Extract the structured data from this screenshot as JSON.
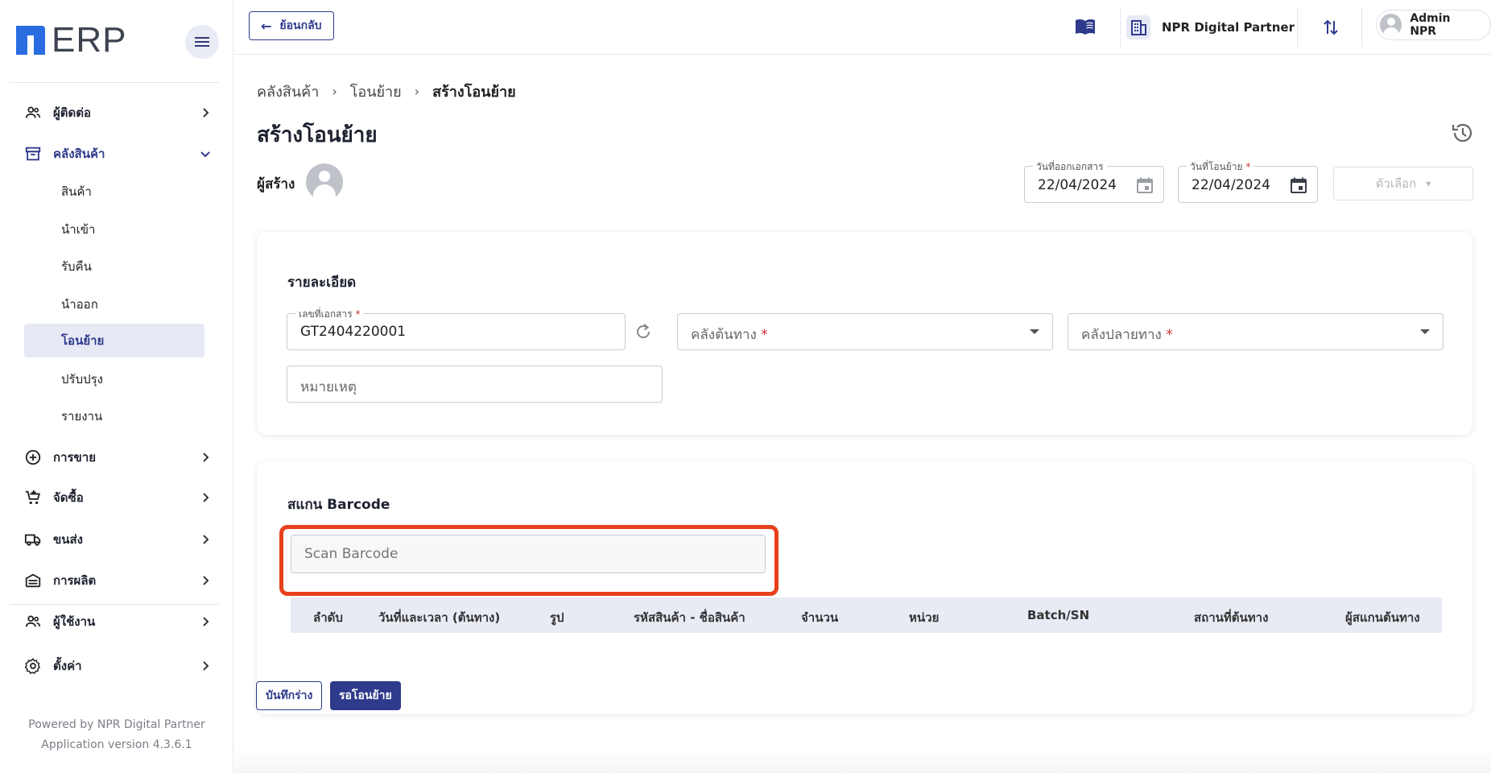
{
  "app": {
    "logo_text": "ERP"
  },
  "sidebar": {
    "items": [
      {
        "label": "ผู้ติดต่อ",
        "icon": "contacts-icon"
      },
      {
        "label": "คลังสินค้า",
        "icon": "warehouse-icon",
        "expanded": true
      },
      {
        "label": "การขาย",
        "icon": "sales-plus-icon"
      },
      {
        "label": "จัดซื้อ",
        "icon": "cart-icon"
      },
      {
        "label": "ขนส่ง",
        "icon": "truck-icon"
      },
      {
        "label": "การผลิต",
        "icon": "factory-icon"
      },
      {
        "label": "ผู้ใช้งาน",
        "icon": "users-icon"
      },
      {
        "label": "ตั้งค่า",
        "icon": "gear-icon"
      }
    ],
    "sub_items": [
      {
        "label": "สินค้า"
      },
      {
        "label": "นำเข้า"
      },
      {
        "label": "รับคืน"
      },
      {
        "label": "นำออก"
      },
      {
        "label": "โอนย้าย",
        "selected": true
      },
      {
        "label": "ปรับปรุง"
      },
      {
        "label": "รายงาน"
      }
    ],
    "footer": {
      "powered_by": "Powered by NPR Digital Partner",
      "version": "Application version 4.3.6.1"
    }
  },
  "topbar": {
    "back_label": "ย้อนกลับ",
    "company": "NPR Digital Partner",
    "user": "Admin NPR"
  },
  "breadcrumb": [
    "คลังสินค้า",
    "โอนย้าย",
    "สร้างโอนย้าย"
  ],
  "page": {
    "title": "สร้างโอนย้าย",
    "creator_label": "ผู้สร้าง"
  },
  "dates": {
    "issue_label": "วันที่ออกเอกสาร",
    "issue_value": "22/04/2024",
    "transfer_label": "วันที่โอนย้าย",
    "transfer_value": "22/04/2024",
    "options_label": "ตัวเลือก"
  },
  "details": {
    "title": "รายละเอียด",
    "doc_no_label": "เลขที่เอกสาร",
    "doc_no_value": "GT2404220001",
    "source_placeholder": "คลังต้นทาง",
    "dest_placeholder": "คลังปลายทาง",
    "remark_placeholder": "หมายเหตุ"
  },
  "scan": {
    "title": "สแกน Barcode",
    "placeholder": "Scan Barcode",
    "highlight_color": "#e8401c"
  },
  "table": {
    "columns": [
      "ลำดับ",
      "วันที่และเวลา (ต้นทาง)",
      "รูป",
      "รหัสสินค้า - ชื่อสินค้า",
      "จำนวน",
      "หน่วย",
      "Batch/SN",
      "สถานที่ต้นทาง",
      "ผู้สแกนต้นทาง"
    ]
  },
  "actions": {
    "save_draft": "บันทึกร่าง",
    "submit": "รอโอนย้าย"
  },
  "colors": {
    "brand": "#2e3a8c",
    "logo_blue": "#2a6de0",
    "required": "#d32f2f"
  }
}
